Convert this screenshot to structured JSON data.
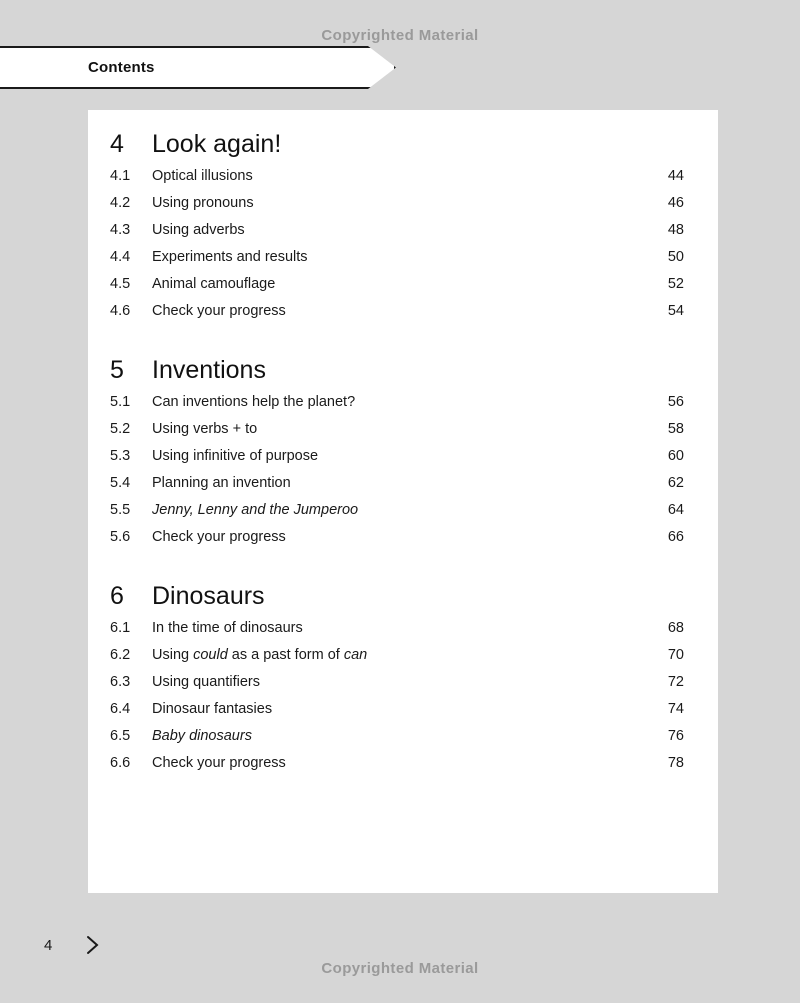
{
  "watermark": {
    "top_text": "Copyrighted Material",
    "bottom_text": "Copyrighted Material",
    "color": "#9a9a9a"
  },
  "tab": {
    "label": "Contents"
  },
  "colors": {
    "background": "#d6d6d6",
    "page": "#ffffff",
    "text": "#1a1a1a",
    "watermark": "#9a9a9a"
  },
  "contents": {
    "sections": [
      {
        "number": "4",
        "title": "Look again!",
        "entries": [
          {
            "number": "4.1",
            "title": "Optical illusions",
            "page": "44",
            "italic": false
          },
          {
            "number": "4.2",
            "title": "Using pronouns",
            "page": "46",
            "italic": false
          },
          {
            "number": "4.3",
            "title": "Using adverbs",
            "page": "48",
            "italic": false
          },
          {
            "number": "4.4",
            "title": "Experiments and results",
            "page": "50",
            "italic": false
          },
          {
            "number": "4.5",
            "title": "Animal camouflage",
            "page": "52",
            "italic": false
          },
          {
            "number": "4.6",
            "title": "Check your progress",
            "page": "54",
            "italic": false
          }
        ]
      },
      {
        "number": "5",
        "title": "Inventions",
        "entries": [
          {
            "number": "5.1",
            "title": "Can inventions help the planet?",
            "page": "56",
            "italic": false
          },
          {
            "number": "5.2",
            "title": "Using verbs + to",
            "page": "58",
            "italic": false
          },
          {
            "number": "5.3",
            "title": "Using infinitive of purpose",
            "page": "60",
            "italic": false
          },
          {
            "number": "5.4",
            "title": "Planning an invention",
            "page": "62",
            "italic": false
          },
          {
            "number": "5.5",
            "title": "Jenny, Lenny and the Jumperoo",
            "page": "64",
            "italic": true
          },
          {
            "number": "5.6",
            "title": "Check your progress",
            "page": "66",
            "italic": false
          }
        ]
      },
      {
        "number": "6",
        "title": "Dinosaurs",
        "entries": [
          {
            "number": "6.1",
            "title": "In the time of dinosaurs",
            "page": "68",
            "italic": false
          },
          {
            "number": "6.2",
            "title": "Using could as a past form of can",
            "page": "70",
            "italic": false,
            "html": "Using <em>could</em> as a past form of <em>can</em>"
          },
          {
            "number": "6.3",
            "title": "Using quantifiers",
            "page": "72",
            "italic": false
          },
          {
            "number": "6.4",
            "title": "Dinosaur fantasies",
            "page": "74",
            "italic": false
          },
          {
            "number": "6.5",
            "title": "Baby dinosaurs",
            "page": "76",
            "italic": true
          },
          {
            "number": "6.6",
            "title": "Check your progress",
            "page": "78",
            "italic": false
          }
        ]
      }
    ]
  },
  "footer": {
    "page_number": "4",
    "next_icon": "chevron-right-icon"
  }
}
